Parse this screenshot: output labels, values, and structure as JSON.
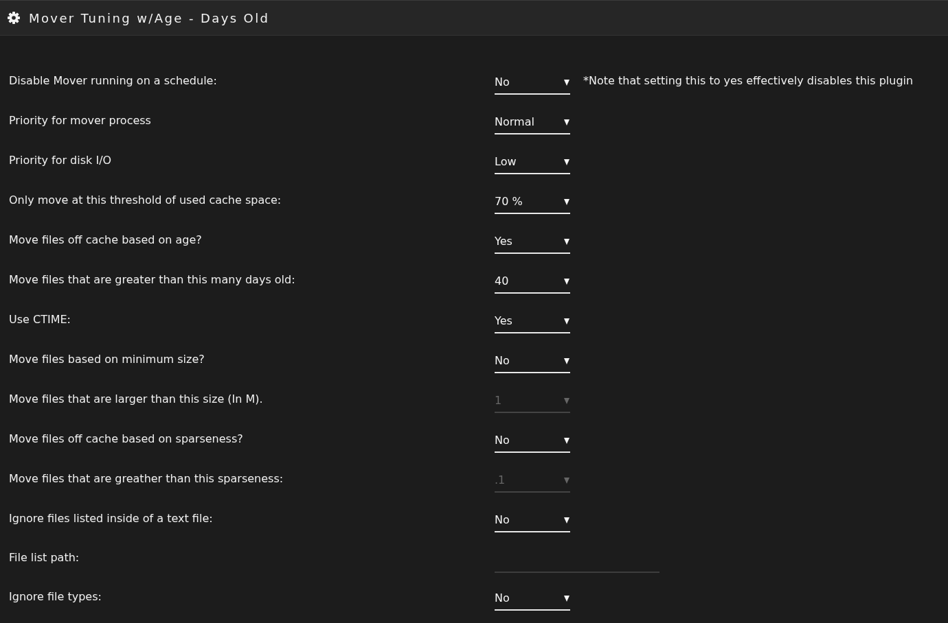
{
  "header": {
    "title": "Mover Tuning w/Age - Days Old"
  },
  "settings": [
    {
      "label": "Disable Mover running on a schedule:",
      "kind": "select",
      "value": "No",
      "disabled": false,
      "note": "*Note that setting this to yes effectively disables this plugin"
    },
    {
      "label": "Priority for mover process",
      "kind": "select",
      "value": "Normal",
      "disabled": false
    },
    {
      "label": "Priority for disk I/O",
      "kind": "select",
      "value": "Low",
      "disabled": false
    },
    {
      "label": "Only move at this threshold of used cache space:",
      "kind": "select",
      "value": "70 %",
      "disabled": false
    },
    {
      "label": "Move files off cache based on age?",
      "kind": "select",
      "value": "Yes",
      "disabled": false
    },
    {
      "label": "Move files that are greater than this many days old:",
      "kind": "select",
      "value": "40",
      "disabled": false
    },
    {
      "label": "Use CTIME:",
      "kind": "select",
      "value": "Yes",
      "disabled": false
    },
    {
      "label": "Move files based on minimum size?",
      "kind": "select",
      "value": "No",
      "disabled": false
    },
    {
      "label": "Move files that are larger than this size (In M).",
      "kind": "select",
      "value": "1",
      "disabled": true
    },
    {
      "label": "Move files off cache based on sparseness?",
      "kind": "select",
      "value": "No",
      "disabled": false
    },
    {
      "label": "Move files that are greather than this sparseness:",
      "kind": "select",
      "value": ".1",
      "disabled": true
    },
    {
      "label": "Ignore files listed inside of a text file:",
      "kind": "select",
      "value": "No",
      "disabled": false
    },
    {
      "label": "File list path:",
      "kind": "text"
    },
    {
      "label": "Ignore file types:",
      "kind": "select",
      "value": "No",
      "disabled": false
    }
  ]
}
